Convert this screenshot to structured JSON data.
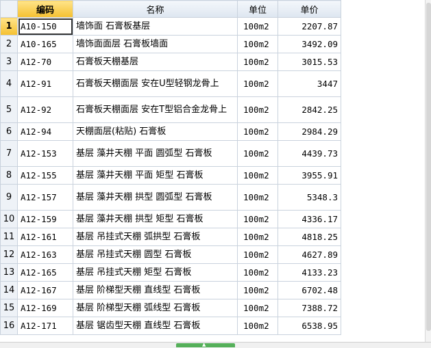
{
  "columns": {
    "index": "",
    "code": "编码",
    "name": "名称",
    "unit": "单位",
    "price": "单价"
  },
  "rows": [
    {
      "idx": "1",
      "code": "A10-150",
      "name": "墙饰面 石膏板基层",
      "unit": "100m2",
      "price": "2207.87"
    },
    {
      "idx": "2",
      "code": "A10-165",
      "name": "墙饰面面层 石膏板墙面",
      "unit": "100m2",
      "price": "3492.09"
    },
    {
      "idx": "3",
      "code": "A12-70",
      "name": "石膏板天棚基层",
      "unit": "100m2",
      "price": "3015.53"
    },
    {
      "idx": "4",
      "code": "A12-91",
      "name": "石膏板天棚面层 安在U型轻钢龙骨上",
      "unit": "100m2",
      "price": "3447"
    },
    {
      "idx": "5",
      "code": "A12-92",
      "name": "石膏板天棚面层 安在T型铝合金龙骨上",
      "unit": "100m2",
      "price": "2842.25"
    },
    {
      "idx": "6",
      "code": "A12-94",
      "name": "天棚面层(粘贴) 石膏板",
      "unit": "100m2",
      "price": "2984.29"
    },
    {
      "idx": "7",
      "code": "A12-153",
      "name": "基层 藻井天棚 平面 圆弧型 石膏板",
      "unit": "100m2",
      "price": "4439.73"
    },
    {
      "idx": "8",
      "code": "A12-155",
      "name": "基层 藻井天棚 平面 矩型 石膏板",
      "unit": "100m2",
      "price": "3955.91"
    },
    {
      "idx": "9",
      "code": "A12-157",
      "name": "基层 藻井天棚 拱型 圆弧型 石膏板",
      "unit": "100m2",
      "price": "5348.3"
    },
    {
      "idx": "10",
      "code": "A12-159",
      "name": "基层 藻井天棚 拱型 矩型 石膏板",
      "unit": "100m2",
      "price": "4336.17"
    },
    {
      "idx": "11",
      "code": "A12-161",
      "name": "基层 吊挂式天棚 弧拱型 石膏板",
      "unit": "100m2",
      "price": "4818.25"
    },
    {
      "idx": "12",
      "code": "A12-163",
      "name": "基层 吊挂式天棚 圆型 石膏板",
      "unit": "100m2",
      "price": "4627.89"
    },
    {
      "idx": "13",
      "code": "A12-165",
      "name": "基层 吊挂式天棚 矩型 石膏板",
      "unit": "100m2",
      "price": "4133.23"
    },
    {
      "idx": "14",
      "code": "A12-167",
      "name": "基层 阶梯型天棚 直线型 石膏板",
      "unit": "100m2",
      "price": "6702.48"
    },
    {
      "idx": "15",
      "code": "A12-169",
      "name": "基层 阶梯型天棚 弧线型 石膏板",
      "unit": "100m2",
      "price": "7388.72"
    },
    {
      "idx": "16",
      "code": "A12-171",
      "name": "基层 锯齿型天棚 直线型 石膏板",
      "unit": "100m2",
      "price": "6538.95"
    }
  ],
  "selected_row": 0,
  "colors": {
    "header_highlight": "#f5c030",
    "grid_line": "#c9d2dd",
    "grip": "#55b05a"
  },
  "icons": {
    "grip": "chevron-up-icon"
  }
}
